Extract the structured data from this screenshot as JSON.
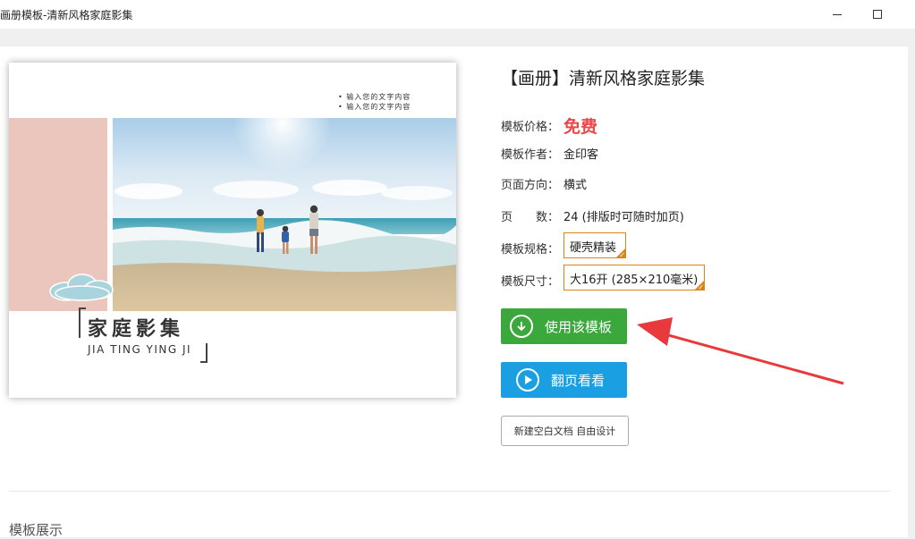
{
  "window": {
    "title": "画册模板-清新风格家庭影集",
    "minimize_icon": "minimize-icon",
    "maximize_icon": "maximize-icon"
  },
  "preview": {
    "note_lines": [
      "输入您的文字内容",
      "输入您的文字内容"
    ],
    "heading": "家庭影集",
    "subheading": "JIA TING YING JI",
    "accent_color": "#ebc6bd"
  },
  "details": {
    "title": "【画册】清新风格家庭影集",
    "price_label": "模板价格：",
    "price_value": "免费",
    "author_label": "模板作者：",
    "author_value": "金印客",
    "orientation_label": "页面方向：",
    "orientation_value": "横式",
    "pages_label": "页　　数：",
    "pages_value": "24 (排版时可随时加页)",
    "spec_label": "模板规格：",
    "spec_value": "硬壳精装",
    "size_label": "模板尺寸：",
    "size_value": "大16开 (285×210毫米)",
    "price_color": "#e8484a",
    "selected_border_color": "#d9851a"
  },
  "actions": {
    "use_template": "使用该模板",
    "use_template_icon": "download-circle-icon",
    "use_color": "#3aa83a",
    "flip_view": "翻页看看",
    "flip_view_icon": "play-circle-icon",
    "flip_color": "#1a9fe3",
    "blank_doc": "新建空白文档 自由设计"
  },
  "section": {
    "showcase_label": "模板展示"
  },
  "annotation": {
    "arrow_color": "#e8393c",
    "arrow_icon": "red-arrow-annotation"
  }
}
